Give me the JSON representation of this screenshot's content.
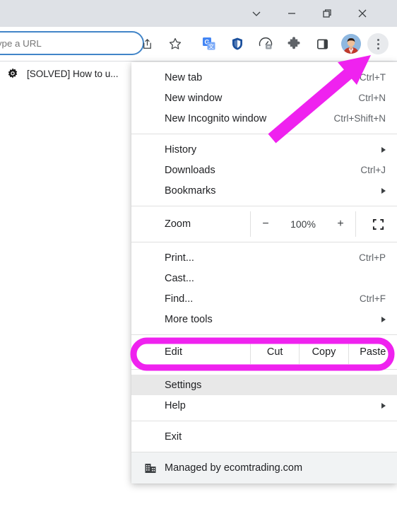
{
  "window": {
    "controls": [
      {
        "name": "chevron-down",
        "label": "⌄"
      },
      {
        "name": "minimize",
        "label": "—"
      },
      {
        "name": "restore",
        "label": "❐"
      },
      {
        "name": "close",
        "label": "✕"
      }
    ]
  },
  "toolbar": {
    "omnibox_value": "",
    "omnibox_placeholder": "Search Google or type a URL",
    "icons": [
      {
        "name": "share-icon",
        "title": "Share this page"
      },
      {
        "name": "bookmark-star-icon",
        "title": "Bookmark this tab"
      },
      {
        "name": "google-translate-icon",
        "title": "Google Translate"
      },
      {
        "name": "shield-password-icon",
        "title": "Password manager"
      },
      {
        "name": "speedometer-icon",
        "title": "Speed test"
      },
      {
        "name": "puzzle-extensions-icon",
        "title": "Extensions"
      },
      {
        "name": "side-panel-icon",
        "title": "Side panel"
      },
      {
        "name": "profile-avatar-icon",
        "title": "Profile"
      },
      {
        "name": "kebab-menu-icon",
        "title": "Customize and control Google Chrome"
      }
    ]
  },
  "tab": {
    "favicon": "gear-icon",
    "title": "[SOLVED] How to u..."
  },
  "menu": {
    "groups": [
      {
        "items": [
          {
            "label": "New tab",
            "accel": "Ctrl+T",
            "submenu": false
          },
          {
            "label": "New window",
            "accel": "Ctrl+N",
            "submenu": false
          },
          {
            "label": "New Incognito window",
            "accel": "Ctrl+Shift+N",
            "submenu": false
          }
        ]
      },
      {
        "items": [
          {
            "label": "History",
            "accel": "",
            "submenu": true
          },
          {
            "label": "Downloads",
            "accel": "Ctrl+J",
            "submenu": false
          },
          {
            "label": "Bookmarks",
            "accel": "",
            "submenu": true
          }
        ]
      }
    ],
    "zoom": {
      "label": "Zoom",
      "minus": "−",
      "value": "100%",
      "plus": "+",
      "fullscreen_icon": "fullscreen-icon"
    },
    "group3": [
      {
        "label": "Print...",
        "accel": "Ctrl+P",
        "submenu": false
      },
      {
        "label": "Cast...",
        "accel": "",
        "submenu": false
      },
      {
        "label": "Find...",
        "accel": "Ctrl+F",
        "submenu": false
      },
      {
        "label": "More tools",
        "accel": "",
        "submenu": true
      }
    ],
    "edit": {
      "label": "Edit",
      "buttons": [
        "Cut",
        "Copy",
        "Paste"
      ]
    },
    "group4": [
      {
        "label": "Settings",
        "accel": "",
        "submenu": false,
        "highlighted": true
      },
      {
        "label": "Help",
        "accel": "",
        "submenu": true
      }
    ],
    "group5": [
      {
        "label": "Exit",
        "accel": "",
        "submenu": false
      }
    ],
    "managed": {
      "icon": "enterprise-building-icon",
      "text": "Managed by ecomtrading.com"
    }
  },
  "annotations": {
    "highlight_color": "#ef22ef",
    "arrow": {
      "name": "pink-arrow-annotation",
      "points_to": "kebab-menu-icon"
    },
    "settings_box": {
      "name": "pink-highlight-box",
      "around": "Settings"
    }
  }
}
